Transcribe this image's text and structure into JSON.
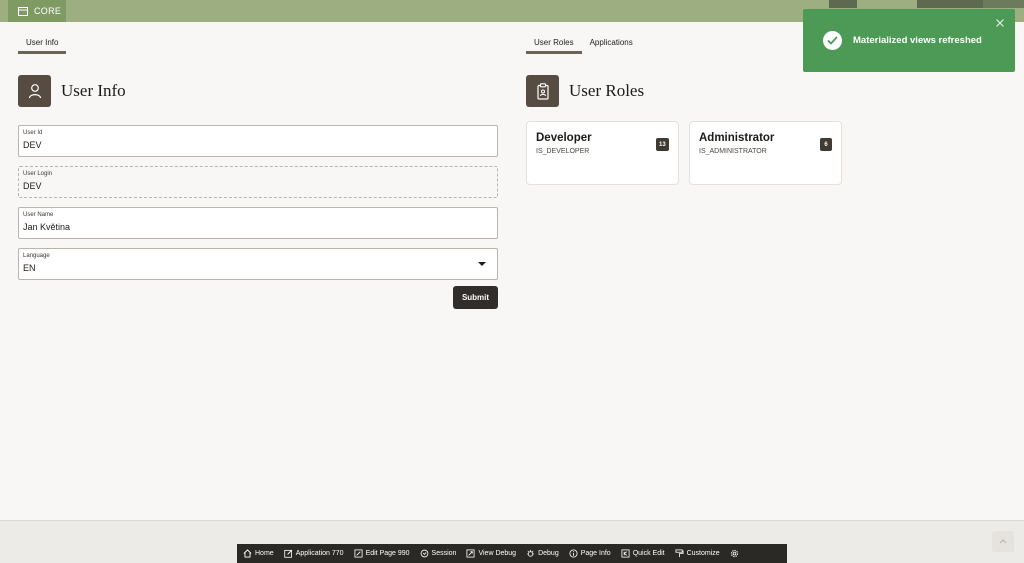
{
  "header": {
    "app_name": "CORE",
    "accent": "#9daf80"
  },
  "left_tabs": [
    {
      "label": "User Info",
      "active": true
    }
  ],
  "right_tabs": [
    {
      "label": "User Roles",
      "active": true
    },
    {
      "label": "Applications",
      "active": false
    }
  ],
  "user_info": {
    "title": "User Info",
    "icon": "user-icon",
    "fields": {
      "user_id": {
        "label": "User Id",
        "value": "DEV"
      },
      "user_login": {
        "label": "User Login",
        "value": "DEV"
      },
      "user_name": {
        "label": "User Name",
        "value": "Jan Květina"
      },
      "language": {
        "label": "Language",
        "value": "EN"
      }
    },
    "submit_label": "Submit"
  },
  "user_roles": {
    "title": "User Roles",
    "icon": "clipboard-badge-icon",
    "roles": [
      {
        "name": "Developer",
        "code": "IS_DEVELOPER",
        "count": "13"
      },
      {
        "name": "Administrator",
        "code": "IS_ADMINISTRATOR",
        "count": "6"
      }
    ]
  },
  "toast": {
    "message": "Materialized views refreshed",
    "color": "#4c9a55"
  },
  "dev_toolbar": {
    "items": [
      {
        "label": "Home",
        "icon": "home-icon"
      },
      {
        "label": "Application 770",
        "icon": "edit-icon"
      },
      {
        "label": "Edit Page 990",
        "icon": "page-edit-icon"
      },
      {
        "label": "Session",
        "icon": "session-icon"
      },
      {
        "label": "View Debug",
        "icon": "view-debug-icon"
      },
      {
        "label": "Debug",
        "icon": "bug-icon"
      },
      {
        "label": "Page Info",
        "icon": "info-icon"
      },
      {
        "label": "Quick Edit",
        "icon": "quick-edit-icon"
      },
      {
        "label": "Customize",
        "icon": "paint-roller-icon"
      },
      {
        "label": "",
        "icon": "gear-icon"
      }
    ]
  }
}
